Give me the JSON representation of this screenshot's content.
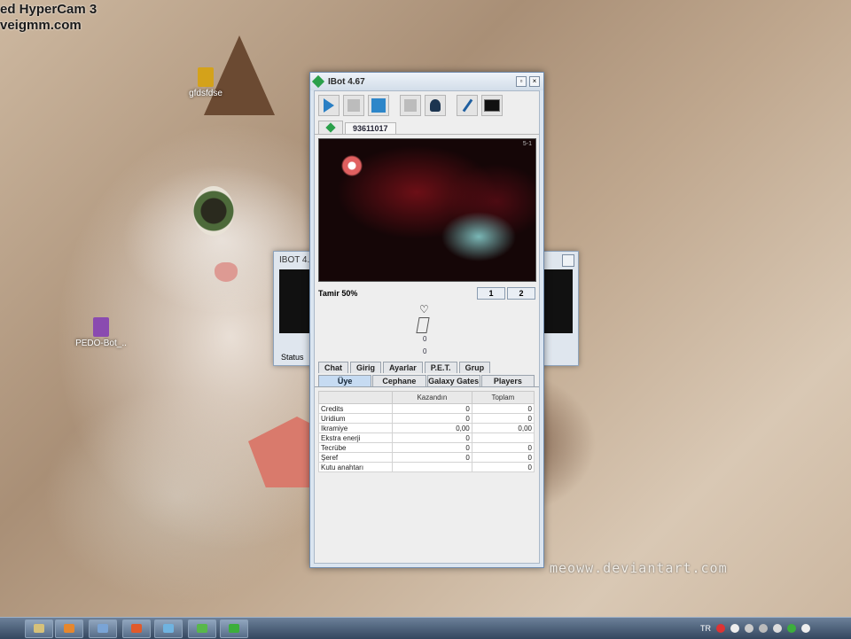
{
  "watermark": {
    "line1": "ed HyperCam 3",
    "line2": "veigmm.com"
  },
  "deviant_text": "meoww.deviantart.com",
  "desktop_icons": [
    {
      "label": "gfdsfdse",
      "color": "#d4a21a"
    },
    {
      "label": "PEDO-Bot_..",
      "color": "#8a4bb0"
    }
  ],
  "back_window": {
    "title": "IBOT 4.",
    "status": "Status"
  },
  "main_window": {
    "title": "IBot 4.67",
    "toolbar_icons": [
      "play-icon",
      "stop-icon",
      "map-icon",
      "blank-icon",
      "ship-icon",
      "pin-icon",
      "monitor-icon"
    ],
    "account_tab": "93611017",
    "map_coord": "5-1",
    "repair_label": "Tamir 50%",
    "config_buttons": [
      "1",
      "2"
    ],
    "drone_val1": "0",
    "drone_val2": "0",
    "tabs_row1": [
      "Chat",
      "Girig",
      "Ayarlar",
      "P.E.T.",
      "Grup"
    ],
    "tabs_row2": [
      "Üye",
      "Cephane",
      "Galaxy Gates",
      "Players"
    ],
    "table": {
      "headers": [
        "",
        "Kazandın",
        "Toplam"
      ],
      "rows": [
        [
          "Credits",
          "0",
          "0"
        ],
        [
          "Uridium",
          "0",
          "0"
        ],
        [
          "Ikramiye",
          "0,00",
          "0,00"
        ],
        [
          "Ekstra enerji",
          "0",
          ""
        ],
        [
          "Tecrübe",
          "0",
          "0"
        ],
        [
          "Şeref",
          "0",
          "0"
        ],
        [
          "Kutu anahtarı",
          "",
          "0"
        ]
      ]
    }
  },
  "tray": {
    "lang": "TR"
  },
  "taskbar_colors": [
    "#d6c17a",
    "#e5872e",
    "#7aa4d6",
    "#e05a2b",
    "#6fb3e0",
    "#58b84a",
    "#3cae3c"
  ]
}
